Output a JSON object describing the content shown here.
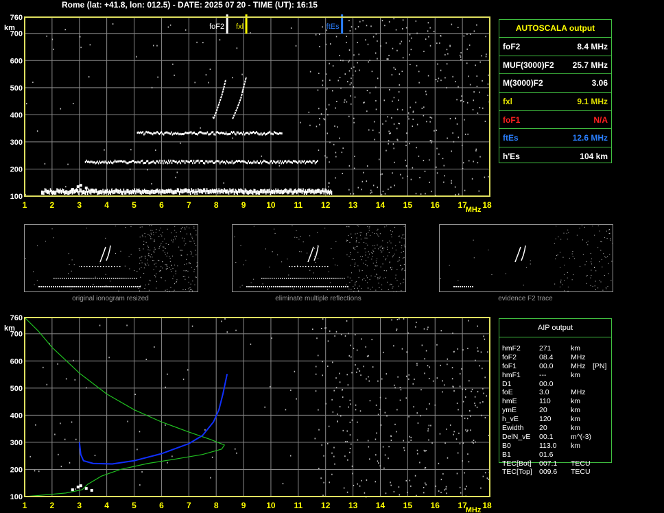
{
  "header": {
    "title": "Rome (lat: +41.8, lon: 012.5) - DATE: 2025 07 20 - TIME (UT): 16:15"
  },
  "colors": {
    "grid": "#8a8a8a",
    "frame": "#e0e060",
    "axis_text": "#ffff00",
    "panel_border": "#40c040",
    "fof2": "#ffffff",
    "fxl": "#ffff00",
    "ftes": "#2a7fff",
    "fof1": "#ff2020",
    "virtual_height_trace": "#1030ff",
    "density_profile": "#20c020"
  },
  "autoscala": {
    "title": "AUTOSCALA output",
    "rows": [
      {
        "label": "foF2",
        "value": "8.4 MHz",
        "color": "#ffffff"
      },
      {
        "label": "MUF(3000)F2",
        "value": "25.7 MHz",
        "color": "#ffffff"
      },
      {
        "label": "M(3000)F2",
        "value": "3.06",
        "color": "#ffffff"
      },
      {
        "label": "fxl",
        "value": "9.1 MHz",
        "color": "#e0e000"
      },
      {
        "label": "foF1",
        "value": "N/A",
        "color": "#ff2020"
      },
      {
        "label": "ftEs",
        "value": "12.6 MHz",
        "color": "#2a7fff"
      },
      {
        "label": "h'Es",
        "value": "104    km",
        "color": "#ffffff"
      }
    ]
  },
  "aip": {
    "title": "AIP output",
    "rows": [
      {
        "name": "hmF2",
        "value": "271",
        "unit": "km",
        "extra": ""
      },
      {
        "name": "foF2",
        "value": "08.4",
        "unit": "MHz",
        "extra": ""
      },
      {
        "name": "foF1",
        "value": "00.0",
        "unit": "MHz",
        "extra": "[PN]"
      },
      {
        "name": "hmF1",
        "value": "---",
        "unit": "km",
        "extra": ""
      },
      {
        "name": "D1",
        "value": "00.0",
        "unit": "",
        "extra": ""
      },
      {
        "name": "foE",
        "value": "3.0",
        "unit": "MHz",
        "extra": ""
      },
      {
        "name": "hmE",
        "value": "110",
        "unit": "km",
        "extra": ""
      },
      {
        "name": "ymE",
        "value": "20",
        "unit": "km",
        "extra": ""
      },
      {
        "name": "h_vE",
        "value": "120",
        "unit": "km",
        "extra": ""
      },
      {
        "name": "Ewidth",
        "value": "20",
        "unit": "km",
        "extra": ""
      },
      {
        "name": "DelN_vE",
        "value": "00.1",
        "unit": "m^(-3)",
        "extra": ""
      },
      {
        "name": "B0",
        "value": "113.0",
        "unit": "km",
        "extra": ""
      },
      {
        "name": "B1",
        "value": "01.6",
        "unit": "",
        "extra": ""
      },
      {
        "name": "TEC[Bot]",
        "value": "007.1",
        "unit": "TECU",
        "extra": ""
      },
      {
        "name": "TEC[Top]",
        "value": "009.6",
        "unit": "TECU",
        "extra": ""
      }
    ]
  },
  "captions": {
    "mini1": "original ionogram resized",
    "mini2": "eliminate multiple reflections",
    "mini3": "evidence F2 trace"
  },
  "chart_data": [
    {
      "type": "scatter",
      "panel": "top-ionogram",
      "xlabel": "MHz",
      "ylabel": "km",
      "x_ticks": [
        1,
        2,
        3,
        4,
        5,
        6,
        7,
        8,
        9,
        10,
        11,
        12,
        13,
        14,
        15,
        16,
        17,
        18
      ],
      "y_ticks": [
        100,
        200,
        300,
        400,
        500,
        600,
        700,
        760
      ],
      "xlim": [
        1,
        18
      ],
      "ylim": [
        100,
        760
      ],
      "grid": true,
      "markers": [
        {
          "name": "foF2",
          "x": 8.4,
          "color": "#ffffff"
        },
        {
          "name": "fxl",
          "x": 9.1,
          "color": "#ffff00"
        },
        {
          "name": "ftEs",
          "x": 12.6,
          "color": "#2a7fff"
        }
      ],
      "traces": [
        {
          "name": "Es",
          "from_x": 1.6,
          "to_x": 12.2,
          "height": 117
        },
        {
          "name": "Es-2",
          "from_x": 3.2,
          "to_x": 11.7,
          "height": 226
        },
        {
          "name": "Es-3",
          "from_x": 5.1,
          "to_x": 10.4,
          "height": 332
        },
        {
          "name": "F2-o",
          "points": [
            [
              7.9,
              385
            ],
            [
              8.0,
              410
            ],
            [
              8.1,
              440
            ],
            [
              8.2,
              470
            ],
            [
              8.28,
              500
            ],
            [
              8.35,
              530
            ]
          ]
        },
        {
          "name": "F2-x",
          "points": [
            [
              8.6,
              385
            ],
            [
              8.75,
              420
            ],
            [
              8.9,
              460
            ],
            [
              9.0,
              500
            ],
            [
              9.1,
              540
            ]
          ]
        }
      ]
    },
    {
      "type": "line",
      "panel": "bottom-profile",
      "xlabel": "MHz",
      "ylabel": "km",
      "x_ticks": [
        1,
        2,
        3,
        4,
        5,
        6,
        7,
        8,
        9,
        10,
        11,
        12,
        13,
        14,
        15,
        16,
        17,
        18
      ],
      "y_ticks": [
        100,
        200,
        300,
        400,
        500,
        600,
        700,
        760
      ],
      "xlim": [
        1,
        18
      ],
      "ylim": [
        100,
        760
      ],
      "grid": true,
      "series": [
        {
          "values": [
            [
              1.0,
              760
            ],
            [
              1.5,
              710
            ],
            [
              2.0,
              650
            ],
            [
              3.0,
              555
            ],
            [
              4.0,
              478
            ],
            [
              5.0,
              420
            ],
            [
              6.0,
              375
            ],
            [
              7.0,
              338
            ],
            [
              7.8,
              310
            ],
            [
              8.3,
              290
            ],
            [
              8.2,
              275
            ],
            [
              7.5,
              255
            ],
            [
              6.5,
              238
            ],
            [
              5.5,
              222
            ],
            [
              4.5,
              200
            ],
            [
              3.8,
              175
            ],
            [
              3.3,
              145
            ],
            [
              3.1,
              125
            ],
            [
              2.5,
              113
            ],
            [
              1.5,
              104
            ],
            [
              1.0,
              100
            ]
          ]
        },
        {
          "values": [
            [
              3.0,
              300
            ],
            [
              3.05,
              255
            ],
            [
              3.15,
              232
            ],
            [
              3.5,
              222
            ],
            [
              4.2,
              220
            ],
            [
              5.0,
              232
            ],
            [
              6.0,
              258
            ],
            [
              7.0,
              295
            ],
            [
              7.5,
              325
            ],
            [
              7.9,
              375
            ],
            [
              8.1,
              420
            ],
            [
              8.25,
              480
            ],
            [
              8.4,
              552
            ]
          ]
        }
      ]
    }
  ]
}
